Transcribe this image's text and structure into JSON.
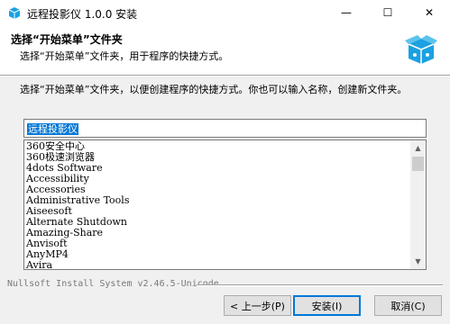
{
  "window": {
    "title": "远程投影仪 1.0.0 安装",
    "minimize_glyph": "—",
    "maximize_glyph": "☐",
    "close_glyph": "✕"
  },
  "header": {
    "title": "选择“开始菜单”文件夹",
    "subtitle": "选择“开始菜单”文件夹，用于程序的快捷方式。"
  },
  "body": {
    "description": "选择“开始菜单”文件夹，以便创建程序的快捷方式。你也可以输入名称，创建新文件夹。",
    "folder_input_value": "远程投影仪"
  },
  "folder_list": {
    "items": [
      "360安全中心",
      "360极速浏览器",
      "4dots Software",
      "Accessibility",
      "Accessories",
      "Administrative Tools",
      "Aiseesoft",
      "Alternate Shutdown",
      "Amazing-Share",
      "Anvisoft",
      "AnyMP4",
      "Avira"
    ]
  },
  "footer": {
    "branding": "Nullsoft Install System v2.46.5-Unicode",
    "back_label": "< 上一步(P)",
    "install_label": "安装(I)",
    "cancel_label": "取消(C)"
  },
  "icons": {
    "app_icon": "package-box-icon",
    "header_icon": "package-box-icon",
    "accent_color": "#1ba1e2"
  }
}
